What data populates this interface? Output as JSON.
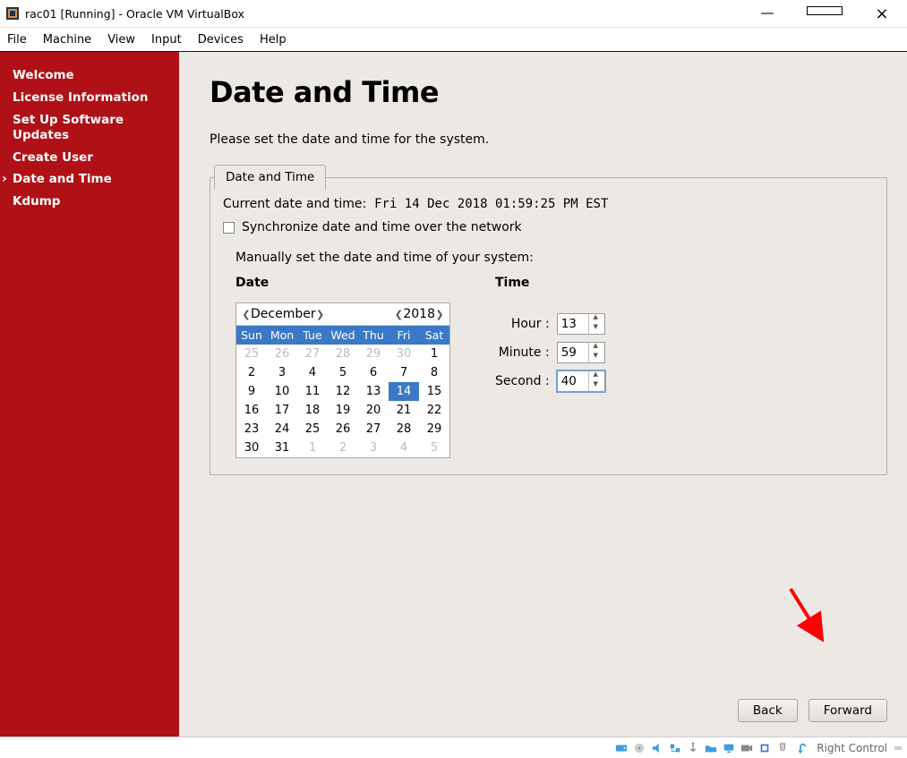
{
  "window": {
    "title": "rac01 [Running] - Oracle VM VirtualBox",
    "minimize_tip": "Minimize",
    "maximize_tip": "Maximize",
    "close_tip": "Close"
  },
  "menubar": {
    "items": [
      "File",
      "Machine",
      "View",
      "Input",
      "Devices",
      "Help"
    ]
  },
  "sidebar": {
    "items": [
      {
        "label": "Welcome"
      },
      {
        "label": "License Information"
      },
      {
        "label": "Set Up Software Updates"
      },
      {
        "label": "Create User"
      },
      {
        "label": "Date and Time",
        "active": true
      },
      {
        "label": "Kdump"
      }
    ]
  },
  "page": {
    "title": "Date and Time",
    "intro": "Please set the date and time for the system.",
    "tab_label": "Date and Time",
    "current_label": "Current date and time:",
    "current_value": "Fri 14 Dec 2018 01:59:25 PM EST",
    "sync_label": "Synchronize date and time over the network",
    "sync_checked": false,
    "manual_label": "Manually set the date and time of your system:",
    "date_heading": "Date",
    "time_heading": "Time",
    "calendar": {
      "month": "December",
      "year": "2018",
      "dow": [
        "Sun",
        "Mon",
        "Tue",
        "Wed",
        "Thu",
        "Fri",
        "Sat"
      ],
      "weeks": [
        [
          {
            "d": "25",
            "dim": true
          },
          {
            "d": "26",
            "dim": true
          },
          {
            "d": "27",
            "dim": true
          },
          {
            "d": "28",
            "dim": true
          },
          {
            "d": "29",
            "dim": true
          },
          {
            "d": "30",
            "dim": true
          },
          {
            "d": "1"
          }
        ],
        [
          {
            "d": "2"
          },
          {
            "d": "3"
          },
          {
            "d": "4"
          },
          {
            "d": "5"
          },
          {
            "d": "6"
          },
          {
            "d": "7"
          },
          {
            "d": "8"
          }
        ],
        [
          {
            "d": "9"
          },
          {
            "d": "10"
          },
          {
            "d": "11"
          },
          {
            "d": "12"
          },
          {
            "d": "13"
          },
          {
            "d": "14",
            "sel": true
          },
          {
            "d": "15"
          }
        ],
        [
          {
            "d": "16"
          },
          {
            "d": "17"
          },
          {
            "d": "18"
          },
          {
            "d": "19"
          },
          {
            "d": "20"
          },
          {
            "d": "21"
          },
          {
            "d": "22"
          }
        ],
        [
          {
            "d": "23"
          },
          {
            "d": "24"
          },
          {
            "d": "25"
          },
          {
            "d": "26"
          },
          {
            "d": "27"
          },
          {
            "d": "28"
          },
          {
            "d": "29"
          }
        ],
        [
          {
            "d": "30"
          },
          {
            "d": "31"
          },
          {
            "d": "1",
            "dim": true
          },
          {
            "d": "2",
            "dim": true
          },
          {
            "d": "3",
            "dim": true
          },
          {
            "d": "4",
            "dim": true
          },
          {
            "d": "5",
            "dim": true
          }
        ]
      ]
    },
    "time": {
      "hour_label": "Hour :",
      "minute_label": "Minute :",
      "second_label": "Second :",
      "hour": "13",
      "minute": "59",
      "second": "40"
    },
    "back_label": "Back",
    "forward_label": "Forward"
  },
  "statusbar": {
    "hostkey": "Right Control"
  }
}
